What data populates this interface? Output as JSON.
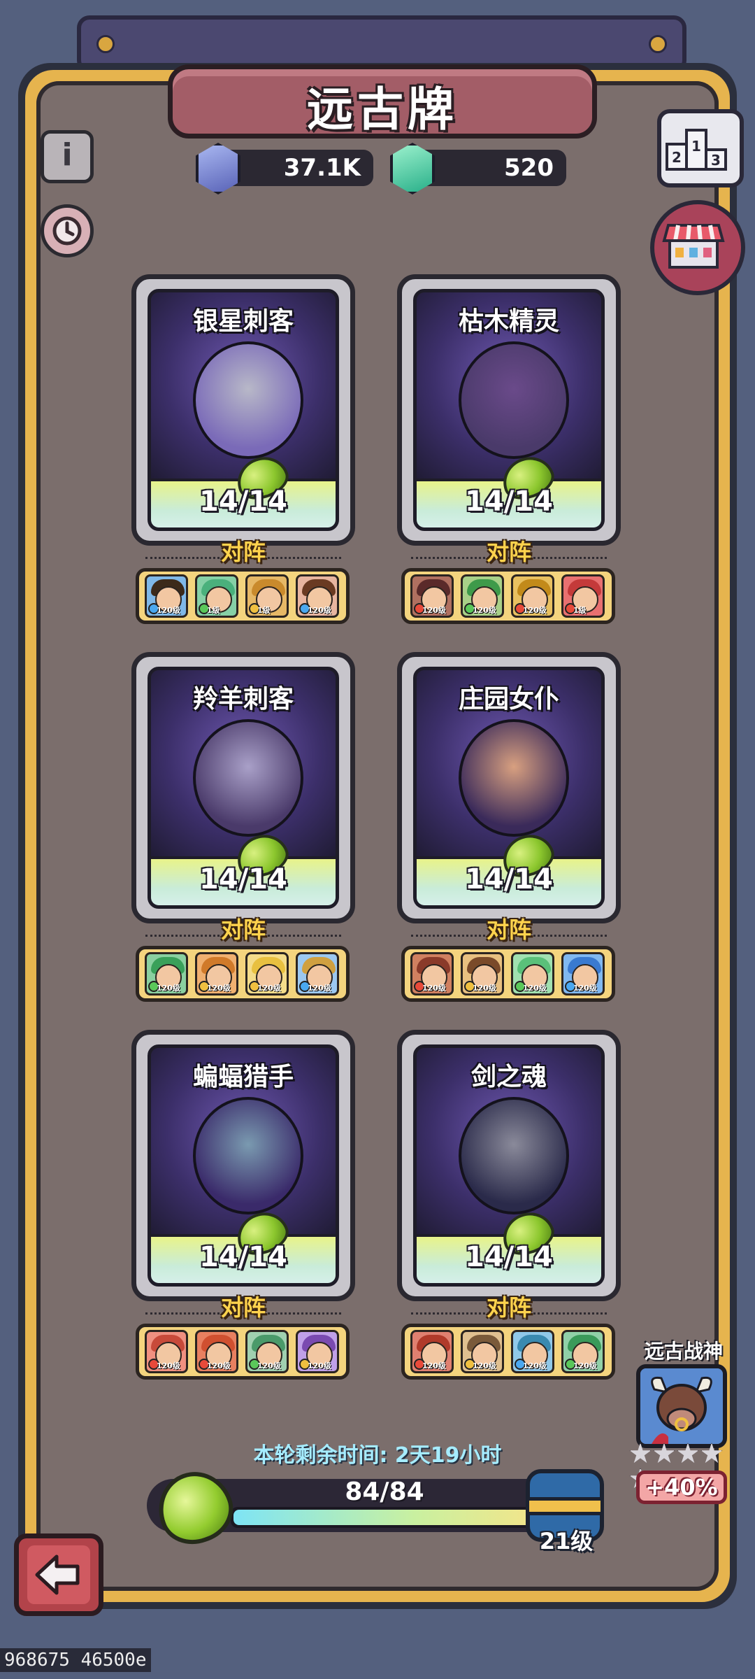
{
  "header": {
    "title": "远古牌"
  },
  "currency": [
    {
      "name": "purple-crystal",
      "value": "37.1K",
      "color": "#7d8fd6"
    },
    {
      "name": "green-crystal",
      "value": "520",
      "color": "#66e0b0"
    }
  ],
  "buttons": {
    "info": "i",
    "ranking_icon": "podium-icon",
    "shop_icon": "shop-stall-icon",
    "history_icon": "clock-icon",
    "back_icon": "back-arrow-icon"
  },
  "cards": [
    {
      "name": "银星刺客",
      "count": "14/14",
      "vs_label": "对阵",
      "team": [
        {
          "level": "120级",
          "element": "water",
          "hair": "#3c2a1a",
          "bg": "#7fb8e8"
        },
        {
          "level": "1级",
          "element": "nature",
          "hair": "#4ab07c",
          "bg": "#86d0a6"
        },
        {
          "level": "1级",
          "element": "light",
          "hair": "#c98a2c",
          "bg": "#e6b866"
        },
        {
          "level": "120级",
          "element": "water",
          "hair": "#6a3a22",
          "bg": "#e8b5a0"
        }
      ]
    },
    {
      "name": "枯木精灵",
      "count": "14/14",
      "vs_label": "对阵",
      "team": [
        {
          "level": "120级",
          "element": "fire",
          "hair": "#5a2a2a",
          "bg": "#b07060"
        },
        {
          "level": "120级",
          "element": "nature",
          "hair": "#3e9a4a",
          "bg": "#a8d088"
        },
        {
          "level": "120级",
          "element": "fire",
          "hair": "#c28a1a",
          "bg": "#e8c060"
        },
        {
          "level": "1级",
          "element": "fire",
          "hair": "#c43a3a",
          "bg": "#e87070"
        }
      ]
    },
    {
      "name": "羚羊刺客",
      "count": "14/14",
      "vs_label": "对阵",
      "team": [
        {
          "level": "120级",
          "element": "nature",
          "hair": "#3aa05a",
          "bg": "#8ad0a0"
        },
        {
          "level": "120级",
          "element": "light",
          "hair": "#d07a2a",
          "bg": "#f0b070"
        },
        {
          "level": "120级",
          "element": "light",
          "hair": "#e8c040",
          "bg": "#f4dc8a"
        },
        {
          "level": "120级",
          "element": "water",
          "hair": "#d0a040",
          "bg": "#9cc8f0"
        }
      ]
    },
    {
      "name": "庄园女仆",
      "count": "14/14",
      "vs_label": "对阵",
      "team": [
        {
          "level": "120级",
          "element": "fire",
          "hair": "#8a3a2a",
          "bg": "#d08060"
        },
        {
          "level": "120级",
          "element": "light",
          "hair": "#7a4a2a",
          "bg": "#e8c080"
        },
        {
          "level": "120级",
          "element": "nature",
          "hair": "#5ac07a",
          "bg": "#a0e0b0"
        },
        {
          "level": "120级",
          "element": "water",
          "hair": "#3a7ad0",
          "bg": "#80b8f0"
        }
      ]
    },
    {
      "name": "蝙蝠猎手",
      "count": "14/14",
      "vs_label": "对阵",
      "team": [
        {
          "level": "120级",
          "element": "fire",
          "hair": "#c84a3a",
          "bg": "#f09080"
        },
        {
          "level": "120级",
          "element": "fire",
          "hair": "#d05030",
          "bg": "#e88060"
        },
        {
          "level": "120级",
          "element": "nature",
          "hair": "#4a9a6a",
          "bg": "#a0d0b0"
        },
        {
          "level": "120级",
          "element": "light",
          "hair": "#7a4ab0",
          "bg": "#c0a0e8"
        }
      ]
    },
    {
      "name": "剑之魂",
      "count": "14/14",
      "vs_label": "对阵",
      "team": [
        {
          "level": "120级",
          "element": "fire",
          "hair": "#b03a2a",
          "bg": "#e08070"
        },
        {
          "level": "120级",
          "element": "light",
          "hair": "#7a5a3a",
          "bg": "#e0c090"
        },
        {
          "level": "120级",
          "element": "water",
          "hair": "#3a8ab0",
          "bg": "#90c8e8"
        },
        {
          "level": "120级",
          "element": "nature",
          "hair": "#3a9a5a",
          "bg": "#90d0a8"
        }
      ]
    }
  ],
  "timer": {
    "label": "本轮剩余时间: 2天19小时"
  },
  "progress": {
    "text": "84/84",
    "fraction": 1.0,
    "level_label": "21级"
  },
  "boss": {
    "title": "远古战神",
    "bonus": "+40%",
    "stars": 5
  },
  "overlay": {
    "text": "968675 46500e"
  }
}
